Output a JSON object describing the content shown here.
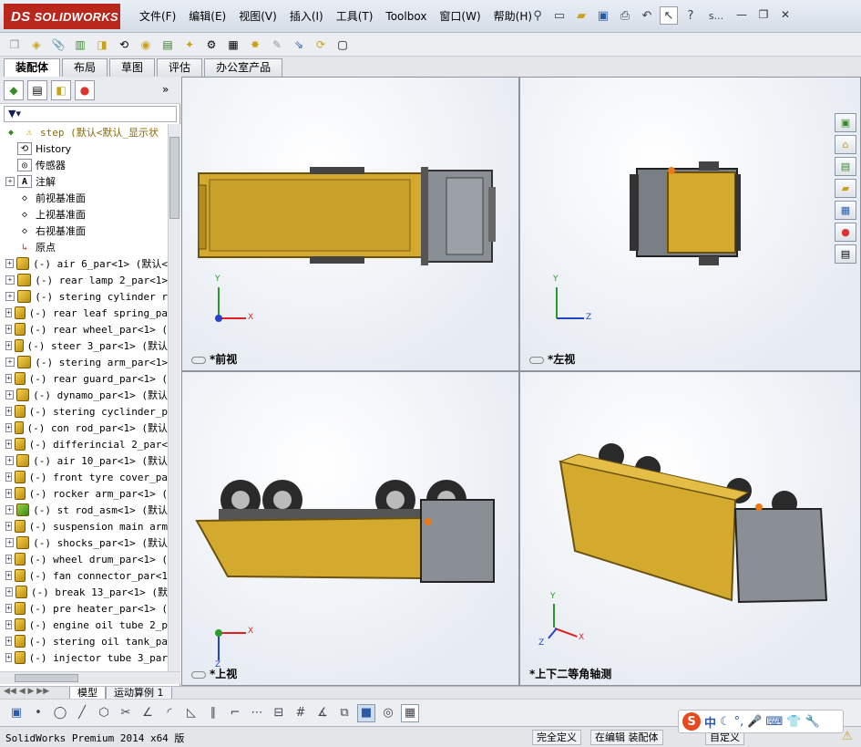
{
  "app": {
    "logo_text": "SOLIDWORKS",
    "logo_prefix": "DS"
  },
  "menu": [
    "文件(F)",
    "编辑(E)",
    "视图(V)",
    "插入(I)",
    "工具(T)",
    "Toolbox",
    "窗口(W)",
    "帮助(H)"
  ],
  "title_right": {
    "search_hint": "s..."
  },
  "command_tabs": [
    "装配体",
    "布局",
    "草图",
    "评估",
    "办公室产品"
  ],
  "active_tab": "装配体",
  "tree": {
    "root": "step  (默认<默认_显示状",
    "items": [
      {
        "label": "History",
        "type": "history",
        "expand": false
      },
      {
        "label": "传感器",
        "type": "sensor",
        "expand": false
      },
      {
        "label": "注解",
        "type": "annotation",
        "expand": true
      },
      {
        "label": "前视基准面",
        "type": "plane",
        "expand": false
      },
      {
        "label": "上视基准面",
        "type": "plane",
        "expand": false
      },
      {
        "label": "右视基准面",
        "type": "plane",
        "expand": false
      },
      {
        "label": "原点",
        "type": "origin",
        "expand": false
      },
      {
        "label": "(-) air 6_par<1> (默认<",
        "type": "part",
        "expand": true
      },
      {
        "label": "(-) rear lamp 2_par<1>",
        "type": "part",
        "expand": true
      },
      {
        "label": "(-) stering cylinder r",
        "type": "part",
        "expand": true
      },
      {
        "label": "(-) rear leaf spring_pa",
        "type": "part",
        "expand": true
      },
      {
        "label": "(-) rear wheel_par<1> (",
        "type": "part",
        "expand": true
      },
      {
        "label": "(-) steer 3_par<1> (默认",
        "type": "part",
        "expand": true
      },
      {
        "label": "(-) stering arm_par<1>",
        "type": "part",
        "expand": true
      },
      {
        "label": "(-) rear guard_par<1> (",
        "type": "part",
        "expand": true
      },
      {
        "label": "(-) dynamo_par<1> (默认",
        "type": "part",
        "expand": true
      },
      {
        "label": "(-) stering cyclinder_p",
        "type": "part",
        "expand": true
      },
      {
        "label": "(-) con rod_par<1> (默认",
        "type": "part",
        "expand": true
      },
      {
        "label": "(-) differincial 2_par<",
        "type": "part",
        "expand": true
      },
      {
        "label": "(-) air 10_par<1> (默认",
        "type": "part",
        "expand": true
      },
      {
        "label": "(-) front tyre cover_pa",
        "type": "part",
        "expand": true
      },
      {
        "label": "(-) rocker arm_par<1> (",
        "type": "part",
        "expand": true
      },
      {
        "label": "(-) st rod_asm<1> (默认",
        "type": "asm",
        "expand": true
      },
      {
        "label": "(-) suspension main arm",
        "type": "part",
        "expand": true
      },
      {
        "label": "(-) shocks_par<1> (默认",
        "type": "part",
        "expand": true
      },
      {
        "label": "(-) wheel drum_par<1> (",
        "type": "part",
        "expand": true
      },
      {
        "label": "(-) fan connector_par<1",
        "type": "part",
        "expand": true
      },
      {
        "label": "(-) break 13_par<1> (默",
        "type": "part",
        "expand": true
      },
      {
        "label": "(-) pre heater_par<1> (",
        "type": "part",
        "expand": true
      },
      {
        "label": "(-) engine oil tube 2_p",
        "type": "part",
        "expand": true
      },
      {
        "label": "(-) stering oil tank_pa",
        "type": "part",
        "expand": true
      },
      {
        "label": "(-) injector tube 3_par",
        "type": "part",
        "expand": true
      }
    ]
  },
  "viewports": {
    "front": "*前视",
    "left": "*左视",
    "top": "*上视",
    "iso": "*上下二等角轴测"
  },
  "axes": {
    "x": "X",
    "y": "Y",
    "z": "Z"
  },
  "model_tabs": [
    "模型",
    "运动算例 1"
  ],
  "status": {
    "version": "SolidWorks Premium 2014 x64 版",
    "definition": "完全定义",
    "editing": "在编辑 装配体",
    "custom": "自定义"
  },
  "ime": {
    "logo": "S",
    "lang": "中"
  },
  "colors": {
    "truck_yellow": "#d4aa2e",
    "cab_gray": "#8a8f96",
    "brand_red": "#b8261c"
  }
}
